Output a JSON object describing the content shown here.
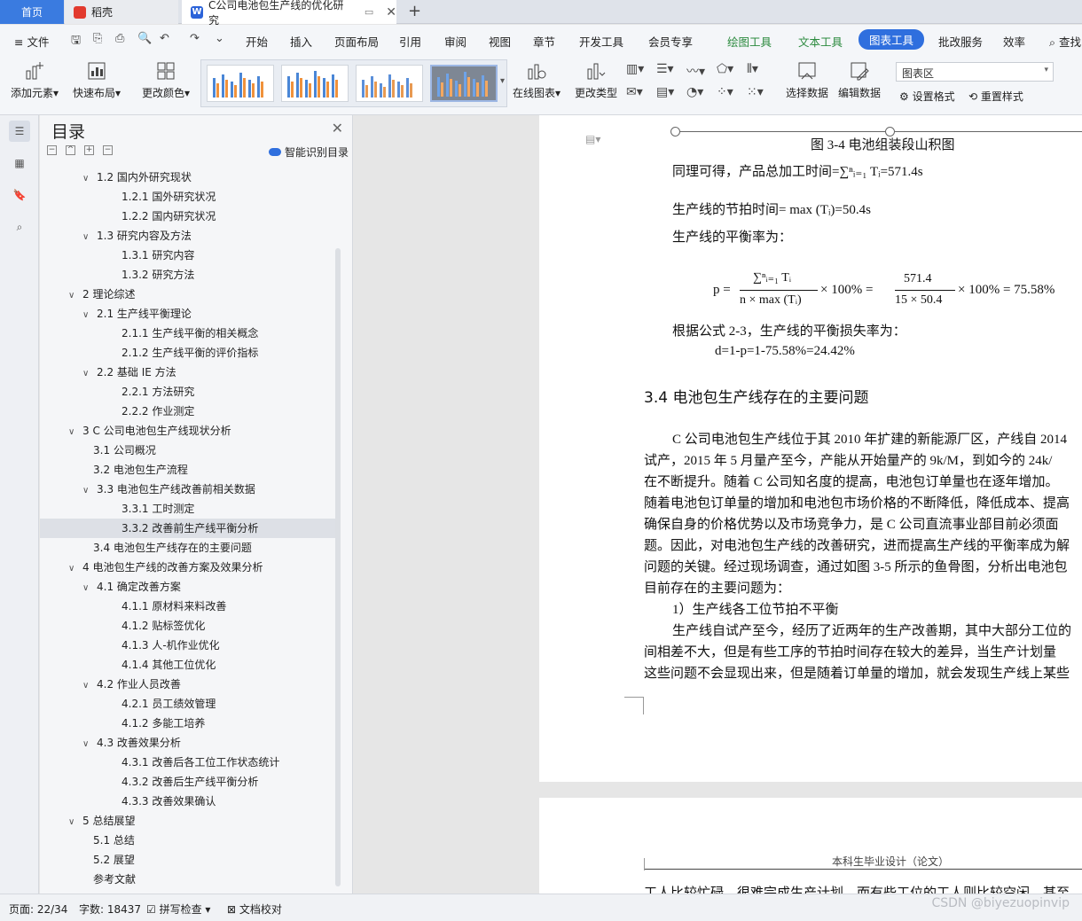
{
  "tabs": {
    "home": "首页",
    "daoke": "稻壳",
    "doc": "C公司电池包生产线的优化研究",
    "add": "+"
  },
  "menu": {
    "file": "文件",
    "items": [
      "开始",
      "插入",
      "页面布局",
      "引用",
      "审阅",
      "视图",
      "章节",
      "开发工具",
      "会员专享"
    ],
    "context": [
      "绘图工具",
      "文本工具"
    ],
    "active": "图表工具",
    "tail": [
      "批改服务",
      "效率"
    ],
    "search": "查找"
  },
  "ribbon": {
    "add_element": "添加元素",
    "quick_layout": "快速布局",
    "change_color": "更改颜色",
    "online_chart": "在线图表",
    "change_type": "更改类型",
    "select_data": "选择数据",
    "edit_data": "编辑数据",
    "chart_area": "图表区",
    "set_format": "设置格式",
    "reset_style": "重置样式"
  },
  "toc": {
    "title": "目录",
    "smart": "智能识别目录",
    "items": [
      {
        "label": "1.2 国内外研究现状",
        "level": 1,
        "chev": "∨"
      },
      {
        "label": "1.2.1 国外研究状况",
        "level": 2
      },
      {
        "label": "1.2.2 国内研究状况",
        "level": 2
      },
      {
        "label": "1.3 研究内容及方法",
        "level": 1,
        "chev": "∨"
      },
      {
        "label": "1.3.1 研究内容",
        "level": 2
      },
      {
        "label": "1.3.2 研究方法",
        "level": 2
      },
      {
        "label": "2 理论综述",
        "level": 0,
        "chev": "∨"
      },
      {
        "label": "2.1 生产线平衡理论",
        "level": 1,
        "chev": "∨"
      },
      {
        "label": "2.1.1 生产线平衡的相关概念",
        "level": 2
      },
      {
        "label": "2.1.2 生产线平衡的评价指标",
        "level": 2
      },
      {
        "label": "2.2 基础 IE 方法",
        "level": 1,
        "chev": "∨"
      },
      {
        "label": "2.2.1 方法研究",
        "level": 2
      },
      {
        "label": "2.2.2 作业测定",
        "level": 2
      },
      {
        "label": "3 C 公司电池包生产线现状分析",
        "level": 0,
        "chev": "∨"
      },
      {
        "label": "3.1 公司概况",
        "level": 1
      },
      {
        "label": "3.2 电池包生产流程",
        "level": 1
      },
      {
        "label": "3.3 电池包生产线改善前相关数据",
        "level": 1,
        "chev": "∨"
      },
      {
        "label": "3.3.1 工时测定",
        "level": 2
      },
      {
        "label": "3.3.2 改善前生产线平衡分析",
        "level": 2,
        "selected": true
      },
      {
        "label": "3.4 电池包生产线存在的主要问题",
        "level": 1
      },
      {
        "label": "4 电池包生产线的改善方案及效果分析",
        "level": 0,
        "chev": "∨"
      },
      {
        "label": "4.1 确定改善方案",
        "level": 1,
        "chev": "∨"
      },
      {
        "label": "4.1.1 原材料来料改善",
        "level": 2
      },
      {
        "label": "4.1.2 贴标签优化",
        "level": 2
      },
      {
        "label": "4.1.3 人-机作业优化",
        "level": 2
      },
      {
        "label": "4.1.4 其他工位优化",
        "level": 2
      },
      {
        "label": "4.2 作业人员改善",
        "level": 1,
        "chev": "∨"
      },
      {
        "label": "4.2.1 员工绩效管理",
        "level": 2
      },
      {
        "label": "4.1.2 多能工培养",
        "level": 2
      },
      {
        "label": "4.3 改善效果分析",
        "level": 1,
        "chev": "∨"
      },
      {
        "label": "4.3.1 改善后各工位工作状态统计",
        "level": 2
      },
      {
        "label": "4.3.2 改善后生产线平衡分析",
        "level": 2
      },
      {
        "label": "4.3.3 改善效果确认",
        "level": 2
      },
      {
        "label": "5 总结展望",
        "level": 0,
        "chev": "∨"
      },
      {
        "label": "5.1 总结",
        "level": 1
      },
      {
        "label": "5.2 展望",
        "level": 1
      },
      {
        "label": "参考文献",
        "level": 1
      }
    ]
  },
  "doc": {
    "fig_caption": "图 3-4  电池组装段山积图",
    "line_total": "同理可得，产品总加工时间=∑ⁿᵢ₌₁ Tᵢ=571.4s",
    "line_takt": "生产线的节拍时间= max (Tᵢ)=50.4s",
    "line_rate": "生产线的平衡率为：",
    "formula_lhs": "p =",
    "formula_num1": "∑ⁿᵢ₌₁ Tᵢ",
    "formula_den1": "n × max (Tᵢ)",
    "formula_mid": "× 100% =",
    "formula_num2": "571.4",
    "formula_den2": "15 × 50.4",
    "formula_end": "× 100% = 75.58%",
    "line_loss": "根据公式 2-3，生产线的平衡损失率为：",
    "line_d": "d=1-p=1-75.58%=24.42%",
    "heading": "3.4 电池包生产线存在的主要问题",
    "para": [
      "C 公司电池包生产线位于其 2010 年扩建的新能源厂区，产线自 2014",
      "试产，2015 年 5 月量产至今，产能从开始量产的 9k/M，到如今的 24k/",
      "在不断提升。随着 C 公司知名度的提高，电池包订单量也在逐年增加。",
      "随着电池包订单量的增加和电池包市场价格的不断降低，降低成本、提高",
      "确保自身的价格优势以及市场竞争力，是 C 公司直流事业部目前必须面",
      "题。因此，对电池包生产线的改善研究，进而提高生产线的平衡率成为解",
      "问题的关键。经过现场调查，通过如图 3-5 所示的鱼骨图，分析出电池包",
      "目前存在的主要问题为：",
      "1）生产线各工位节拍不平衡",
      "生产线自试产至今，经历了近两年的生产改善期，其中大部分工位的",
      "间相差不大，但是有些工序的节拍时间存在较大的差异，当生产计划量",
      "这些问题不会显现出来，但是随着订单量的增加，就会发现生产线上某些"
    ],
    "page2_header": "本科生毕业设计（论文）",
    "page2_line": "工人比较忙碌，很难完成生产计划，而有些工位的工人则比较空闲，甚至"
  },
  "status": {
    "page": "页面: 22/34",
    "words": "字数: 18437",
    "spell": "拼写检查",
    "proof": "文档校对"
  },
  "watermark": "CSDN @biyezuopinvip"
}
